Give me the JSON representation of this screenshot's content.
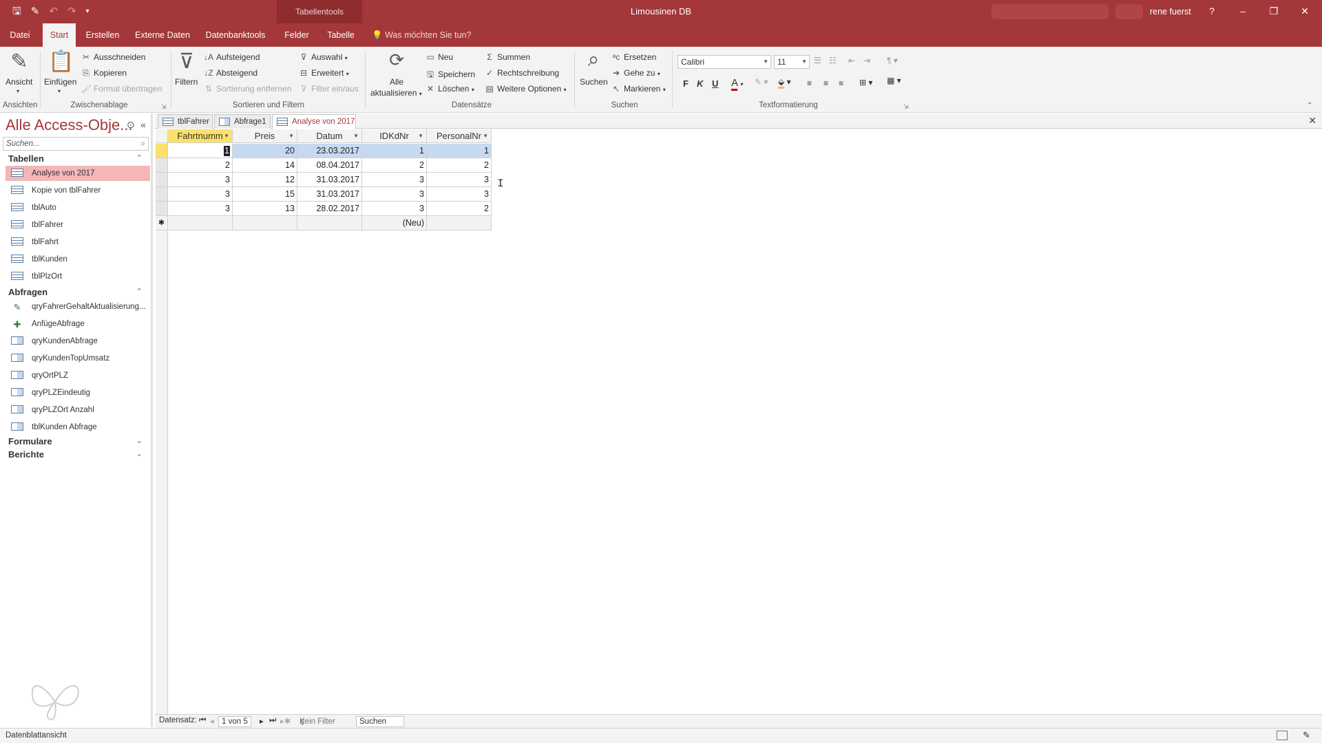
{
  "window": {
    "app_title": "Limousinen DB",
    "context_tab_group": "Tabellentools",
    "user": "rene fuerst",
    "help": "?",
    "minimize": "–",
    "restore": "❐",
    "close": "✕"
  },
  "ribbon_tabs": [
    "Datei",
    "Start",
    "Erstellen",
    "Externe Daten",
    "Datenbanktools",
    "Felder",
    "Tabelle"
  ],
  "active_tab": "Start",
  "tell_me": "Was möchten Sie tun?",
  "ribbon": {
    "ansichten": {
      "group": "Ansichten",
      "ansicht": "Ansicht"
    },
    "zwischenablage": {
      "group": "Zwischenablage",
      "einfuegen": "Einfügen",
      "ausschneiden": "Ausschneiden",
      "kopieren": "Kopieren",
      "format": "Format übertragen"
    },
    "sortieren": {
      "group": "Sortieren und Filtern",
      "filtern": "Filtern",
      "aufsteigend": "Aufsteigend",
      "absteigend": "Absteigend",
      "sortierung_entfernen": "Sortierung entfernen",
      "auswahl": "Auswahl",
      "erweitert": "Erweitert",
      "filter_ein_aus": "Filter ein/aus"
    },
    "datensaetze": {
      "group": "Datensätze",
      "alle": "Alle",
      "aktualisieren": "aktualisieren",
      "neu": "Neu",
      "speichern": "Speichern",
      "loeschen": "Löschen",
      "summen": "Summen",
      "rechtschreibung": "Rechtschreibung",
      "weitere": "Weitere Optionen"
    },
    "suchen": {
      "group": "Suchen",
      "suchen": "Suchen",
      "ersetzen": "Ersetzen",
      "gehe_zu": "Gehe zu",
      "markieren": "Markieren"
    },
    "text": {
      "group": "Textformatierung",
      "font": "Calibri",
      "size": "11",
      "bold": "F",
      "italic": "K",
      "underline": "U"
    }
  },
  "nav": {
    "title": "Alle Access-Obje...",
    "search_placeholder": "Suchen...",
    "sections": {
      "tabellen": {
        "label": "Tabellen",
        "items": [
          "Analyse von 2017",
          "Kopie von tblFahrer",
          "tblAuto",
          "tblFahrer",
          "tblFahrt",
          "tblKunden",
          "tblPlzOrt"
        ]
      },
      "abfragen": {
        "label": "Abfragen",
        "items": [
          "qryFahrerGehaltAktualisierung...",
          "AnfügeAbfrage",
          "qryKundenAbfrage",
          "qryKundenTopUmsatz",
          "qryOrtPLZ",
          "qryPLZEindeutig",
          "qryPLZOrt Anzahl",
          "tblKunden Abfrage"
        ]
      },
      "formulare": {
        "label": "Formulare"
      },
      "berichte": {
        "label": "Berichte"
      }
    },
    "selected_item": "Analyse von 2017"
  },
  "doc_tabs": [
    "tblFahrer",
    "Abfrage1",
    "Analyse von 2017"
  ],
  "active_doc_tab": "Analyse von 2017",
  "datasheet": {
    "columns": [
      "Fahrtnumm",
      "Preis",
      "Datum",
      "IDKdNr",
      "PersonalNr"
    ],
    "rows": [
      [
        "1",
        "20",
        "23.03.2017",
        "1",
        "1"
      ],
      [
        "2",
        "14",
        "08.04.2017",
        "2",
        "2"
      ],
      [
        "3",
        "12",
        "31.03.2017",
        "3",
        "3"
      ],
      [
        "3",
        "15",
        "31.03.2017",
        "3",
        "3"
      ],
      [
        "3",
        "13",
        "28.02.2017",
        "3",
        "2"
      ]
    ],
    "new_row_label": "(Neu)",
    "new_row_marker": "✱"
  },
  "record_nav": {
    "label": "Datensatz:",
    "position": "1 von 5",
    "filter": "Kein Filter",
    "search": "Suchen"
  },
  "status": {
    "view": "Datenblattansicht"
  },
  "colors": {
    "accent": "#a4373a",
    "selection": "#c6d9f0",
    "highlight": "#fbe16b",
    "nav_selected": "#f4b6b8"
  }
}
